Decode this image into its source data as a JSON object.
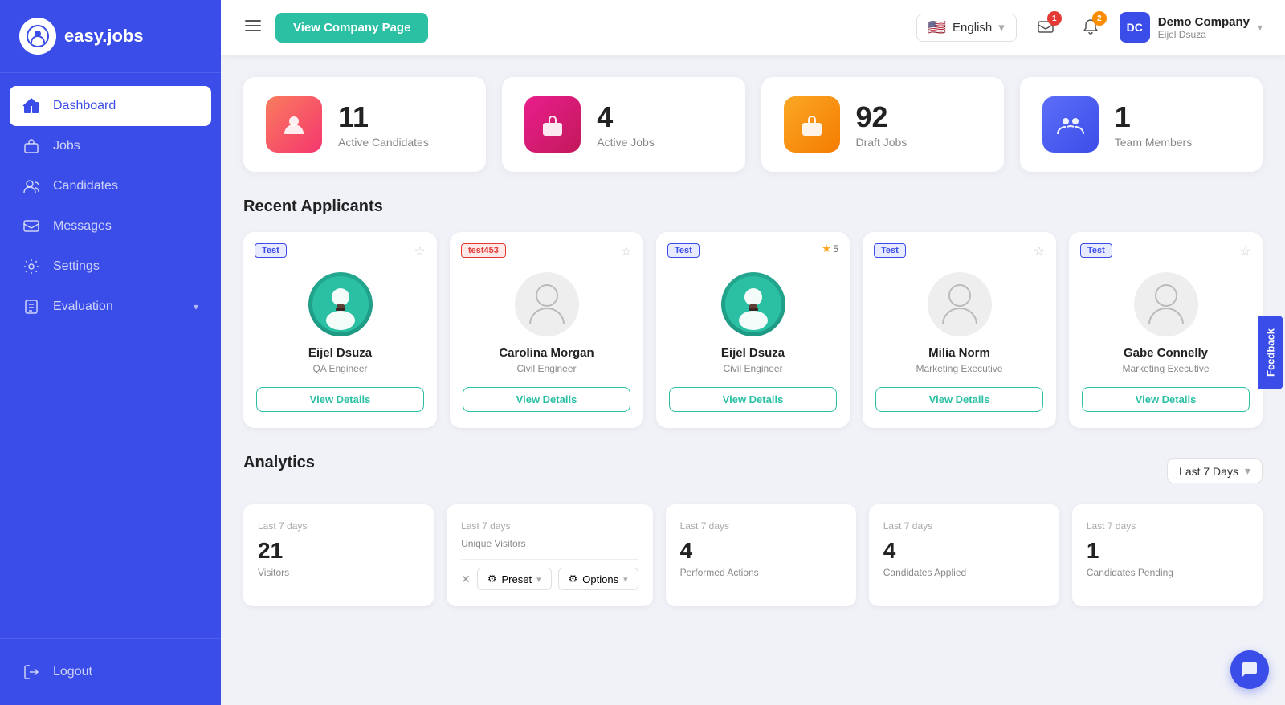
{
  "sidebar": {
    "logo_text": "easy.jobs",
    "items": [
      {
        "label": "Dashboard",
        "icon": "home-icon",
        "active": true
      },
      {
        "label": "Jobs",
        "icon": "briefcase-icon",
        "active": false
      },
      {
        "label": "Candidates",
        "icon": "candidates-icon",
        "active": false
      },
      {
        "label": "Messages",
        "icon": "messages-icon",
        "active": false
      },
      {
        "label": "Settings",
        "icon": "settings-icon",
        "active": false
      },
      {
        "label": "Evaluation",
        "icon": "evaluation-icon",
        "active": false
      }
    ],
    "logout_label": "Logout"
  },
  "header": {
    "view_company_label": "View Company Page",
    "language": "English",
    "messages_badge": "1",
    "notifications_badge": "2",
    "company_name": "Demo Company",
    "company_user": "Eijel Dsuza"
  },
  "stats": [
    {
      "number": "11",
      "label": "Active Candidates",
      "color": "#f5a623",
      "gradient": "linear-gradient(135deg,#f97c5e,#f5366e)"
    },
    {
      "number": "4",
      "label": "Active Jobs",
      "color": "#e91e8c",
      "gradient": "linear-gradient(135deg,#e91e8c,#c2185b)"
    },
    {
      "number": "92",
      "label": "Draft Jobs",
      "color": "#fb8c00",
      "gradient": "linear-gradient(135deg,#fba726,#f57c00)"
    },
    {
      "number": "1",
      "label": "Team Members",
      "color": "#3b4de8",
      "gradient": "linear-gradient(135deg,#5c6ef8,#3b4de8)"
    }
  ],
  "recent_applicants": {
    "title": "Recent Applicants",
    "candidates": [
      {
        "tag": "Test",
        "tag_type": "test",
        "name": "Eijel Dsuza",
        "role": "QA Engineer",
        "has_avatar": true,
        "star": false,
        "rating": null
      },
      {
        "tag": "test453",
        "tag_type": "test453",
        "name": "Carolina Morgan",
        "role": "Civil Engineer",
        "has_avatar": false,
        "star": false,
        "rating": null
      },
      {
        "tag": "Test",
        "tag_type": "test",
        "name": "Eijel Dsuza",
        "role": "Civil Engineer",
        "has_avatar": true,
        "star": true,
        "rating": "5"
      },
      {
        "tag": "Test",
        "tag_type": "test",
        "name": "Milia Norm",
        "role": "Marketing Executive",
        "has_avatar": false,
        "star": false,
        "rating": null
      },
      {
        "tag": "Test",
        "tag_type": "test",
        "name": "Gabe Connelly",
        "role": "Marketing Executive",
        "has_avatar": false,
        "star": false,
        "rating": null
      }
    ],
    "view_details_label": "View Details"
  },
  "analytics": {
    "title": "Analytics",
    "period_label": "Last 7 Days",
    "cards": [
      {
        "period": "Last 7 days",
        "number": "21",
        "label": "Visitors"
      },
      {
        "period": "Last 7 days",
        "number": "",
        "label": "Unique Visitors"
      },
      {
        "period": "Last 7 days",
        "number": "4",
        "label": "Performed Actions"
      },
      {
        "period": "Last 7 days",
        "number": "4",
        "label": "Candidates Applied"
      },
      {
        "period": "Last 7 days",
        "number": "1",
        "label": "Candidates Pending"
      }
    ]
  },
  "preset_bar": {
    "preset_label": "Preset",
    "options_label": "Options"
  },
  "feedback_label": "Feedback"
}
